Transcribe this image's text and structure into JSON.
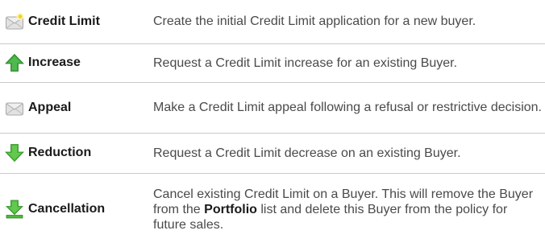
{
  "rows": [
    {
      "icon": "envelope-new-icon",
      "name": "Credit Limit",
      "desc": "Create the initial Credit Limit application for a new buyer."
    },
    {
      "icon": "arrow-up-icon",
      "name": "Increase",
      "desc": "Request a Credit Limit increase for an existing Buyer."
    },
    {
      "icon": "envelope-icon",
      "name": "Appeal",
      "desc": "Make a Credit Limit appeal following a refusal or restrictive decision."
    },
    {
      "icon": "arrow-down-icon",
      "name": "Reduction",
      "desc": "Request a Credit Limit decrease on an existing Buyer."
    },
    {
      "icon": "arrow-down-to-line-icon",
      "name": "Cancellation",
      "desc_before": "Cancel existing Credit Limit on a Buyer. This will remove the Buyer from the",
      "desc_bold": "Portfolio",
      "desc_after": "list and delete this Buyer from the policy for future sales."
    }
  ],
  "colors": {
    "arrow_up_green": "#3aa53a",
    "arrow_down_green": "#4cb83a",
    "envelope_gray": "#d8d8d8",
    "star_yellow": "#f5d21e",
    "divider": "#c9c9c9"
  }
}
